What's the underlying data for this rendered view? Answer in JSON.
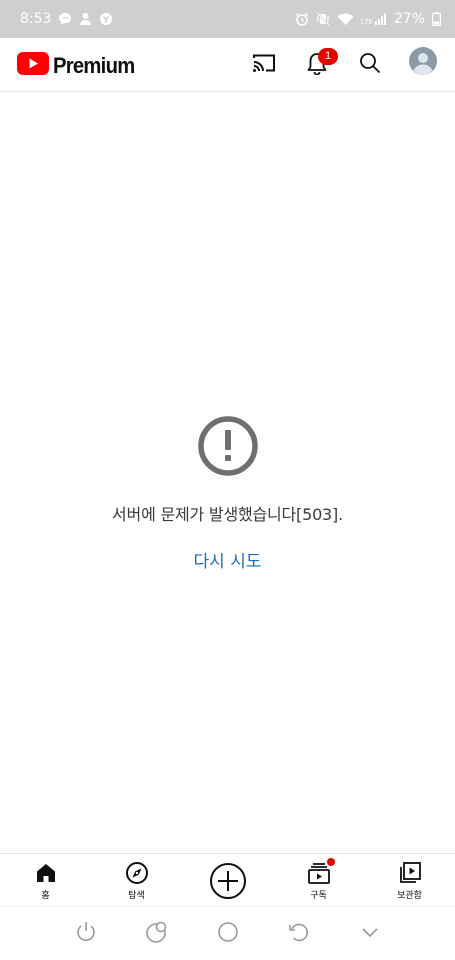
{
  "status_bar": {
    "time": "8:53",
    "battery_percent": "27%",
    "icons": [
      "chat-bubble-icon",
      "person-notification-icon",
      "app-notification-icon",
      "alarm-icon",
      "vibrate-off-icon",
      "wifi-icon",
      "lte-signal-icon",
      "battery-icon"
    ]
  },
  "app_bar": {
    "logo_text": "Premium",
    "notification_count": "1",
    "icons": [
      "cast-icon",
      "bell-icon",
      "search-icon",
      "account-avatar-icon"
    ]
  },
  "error": {
    "message": "서버에 문제가 발생했습니다[503].",
    "retry_label": "다시 시도"
  },
  "bottom_nav": {
    "items": [
      {
        "label": "홈",
        "icon": "home-icon"
      },
      {
        "label": "탐색",
        "icon": "compass-icon"
      },
      {
        "label": "",
        "icon": "create-plus-icon"
      },
      {
        "label": "구독",
        "icon": "subscriptions-icon"
      },
      {
        "label": "보관함",
        "icon": "library-icon"
      }
    ]
  },
  "system_nav": {
    "icons": [
      "power-icon",
      "assistant-icon",
      "home-circle-icon",
      "rotate-icon",
      "chevron-down-icon"
    ]
  },
  "colors": {
    "status_bar_bg": "#cfcfcf",
    "youtube_red": "#ff0000",
    "badge_red": "#e10600",
    "retry_link": "#1b6fb5",
    "error_icon_gray": "#6f6f6f"
  }
}
